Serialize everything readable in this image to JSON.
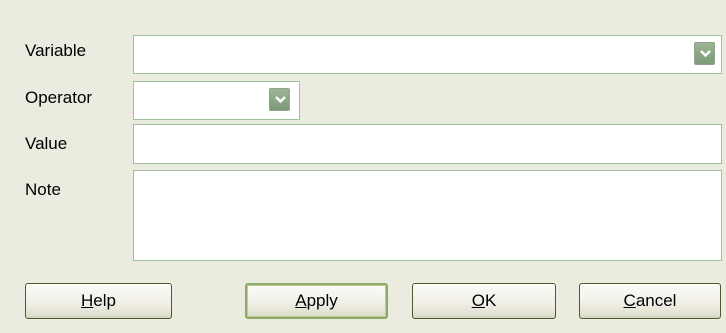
{
  "form": {
    "variable_label": "Variable",
    "operator_label": "Operator",
    "value_label": "Value",
    "note_label": "Note",
    "variable_value": "",
    "operator_value": "",
    "value_value": "",
    "note_value": ""
  },
  "buttons": {
    "help": {
      "mnemonic": "H",
      "rest": "elp"
    },
    "apply": {
      "mnemonic": "A",
      "rest": "pply"
    },
    "ok": {
      "mnemonic": "O",
      "rest": "K"
    },
    "cancel": {
      "mnemonic": "C",
      "rest": "ancel"
    }
  },
  "icons": {
    "combo_arrow": "chevron-down-icon"
  },
  "colors": {
    "dialog_bg": "#ecebdf",
    "field_border": "#9ec39c",
    "combo_button": "#8aa684",
    "default_button_border": "#8ea869",
    "button_border": "#4e5a2f"
  }
}
